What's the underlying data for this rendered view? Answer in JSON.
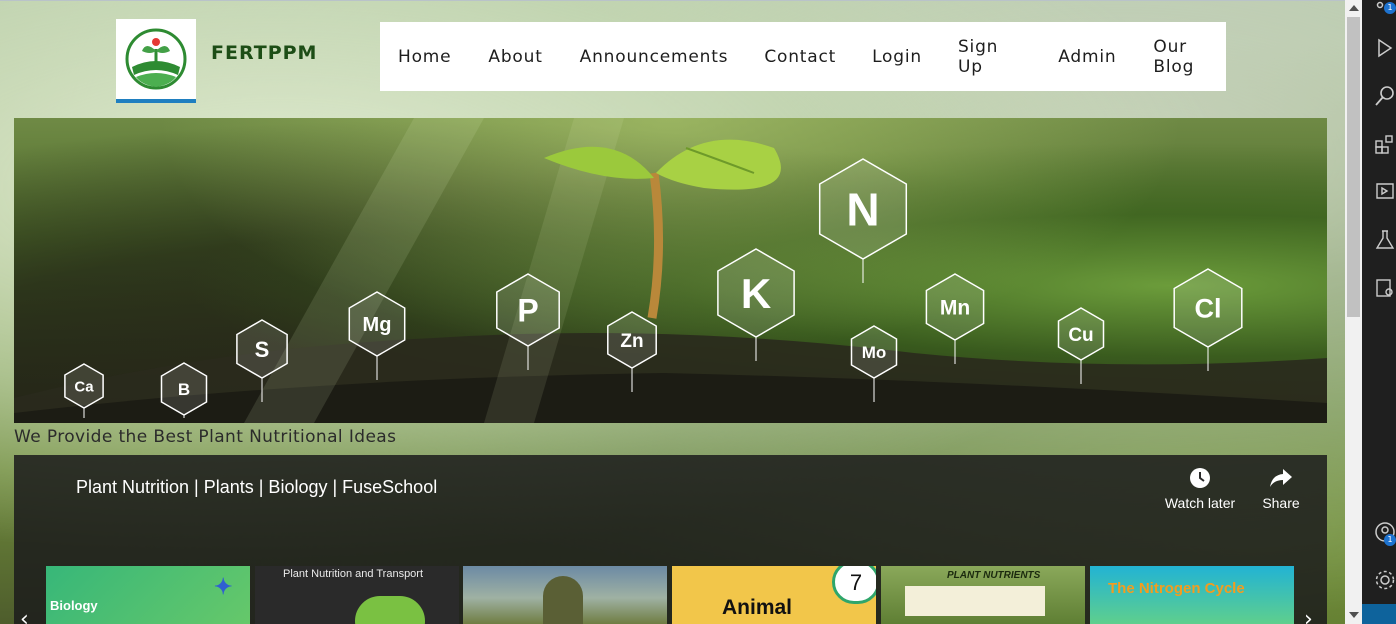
{
  "brand": {
    "name": "FERTPPM",
    "logo": "fertppm-leaf-logo"
  },
  "nav": {
    "items": [
      "Home",
      "About",
      "Announcements",
      "Contact",
      "Login",
      "Sign Up",
      "Admin",
      "Our Blog"
    ]
  },
  "hero": {
    "elements": [
      "Ca",
      "B",
      "S",
      "Mg",
      "P",
      "Zn",
      "K",
      "N",
      "Mo",
      "Mn",
      "Cu",
      "Cl"
    ]
  },
  "tagline": "We Provide the Best Plant Nutritional Ideas",
  "video": {
    "title": "Plant Nutrition | Plants | Biology | FuseSchool",
    "watch_later_label": "Watch later",
    "share_label": "Share",
    "thumbnails": [
      {
        "label": "Biology",
        "color": "#3fb86c"
      },
      {
        "label": "Plant Nutrition and Transport",
        "color": "#ffffff"
      },
      {
        "label": "",
        "color": "#4b6f86"
      },
      {
        "label": "Animal",
        "badge": "7",
        "color": "#f2c64a"
      },
      {
        "label": "PLANT NUTRIENTS",
        "color": "#7a9b4b"
      },
      {
        "label": "The Nitrogen Cycle",
        "color": "#28b7d6"
      }
    ]
  },
  "activity_bar": {
    "badges": [
      "1",
      "1"
    ],
    "icons": [
      "source-control-icon",
      "run-debug-icon",
      "search-icon",
      "extensions-icon",
      "remote-explorer-icon",
      "testing-icon",
      "docker-icon",
      "account-icon",
      "settings-gear-icon",
      "remote-indicator-icon"
    ]
  },
  "colors": {
    "brand_green": "#1d4d16",
    "logo_blue": "#1f7fc0",
    "activity_bg": "#1f1f1f",
    "vscode_blue": "#0e639c"
  }
}
